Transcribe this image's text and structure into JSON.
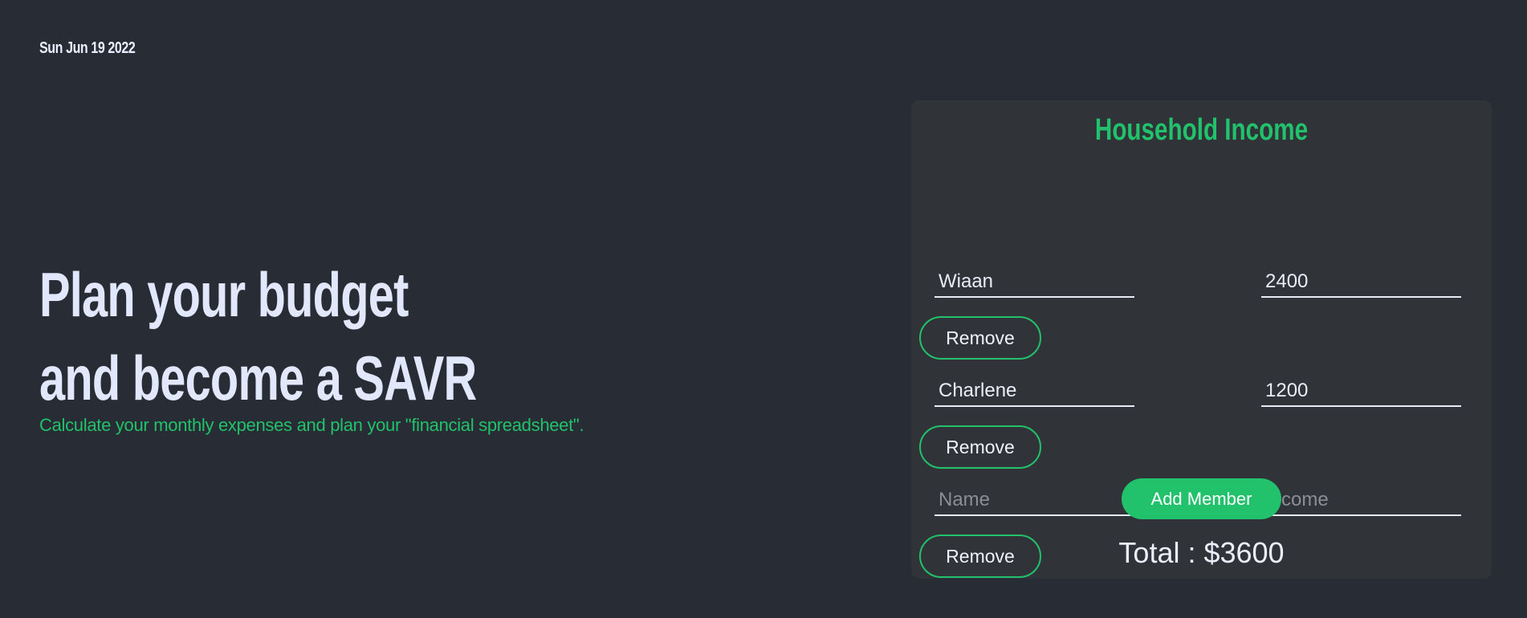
{
  "header": {
    "date": "Sun Jun 19 2022"
  },
  "hero": {
    "line1": "Plan your budget",
    "line2": "and become a SAVR",
    "tagline": "Calculate your monthly expenses and plan your \"financial spreadsheet\"."
  },
  "income_card": {
    "title": "Household Income",
    "members": [
      {
        "name": "Wiaan",
        "income": "2400",
        "remove_label": "Remove"
      },
      {
        "name": "Charlene",
        "income": "1200",
        "remove_label": "Remove"
      },
      {
        "name": "",
        "income": "",
        "remove_label": "Remove"
      }
    ],
    "placeholders": {
      "name": "Name",
      "income": "Income"
    },
    "add_label": "Add Member",
    "total_label": "Total : $3600"
  },
  "colors": {
    "background": "#282c34",
    "card": "#303338",
    "accent": "#22c16b",
    "text": "#e2e8fb"
  }
}
